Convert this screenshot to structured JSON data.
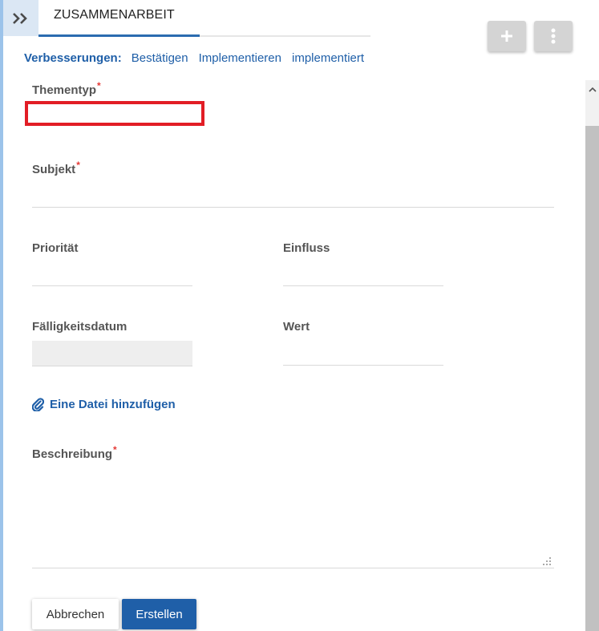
{
  "header": {
    "expand_icon": "double-chevron-right-icon",
    "tab_title": "ZUSAMMENARBEIT",
    "add_icon": "plus-icon",
    "more_icon": "vertical-dots-icon",
    "accent_color": "#2b6cb0"
  },
  "workflow": {
    "label": "Verbesserungen:",
    "steps": [
      "Bestätigen",
      "Implementieren",
      "implementiert"
    ]
  },
  "form": {
    "required_marker": "*",
    "themen_typ": {
      "label": "Thementyp",
      "value": ""
    },
    "subjekt": {
      "label": "Subjekt",
      "value": ""
    },
    "prioritaet": {
      "label": "Priorität",
      "value": ""
    },
    "einfluss": {
      "label": "Einfluss",
      "value": ""
    },
    "faelligkeitsdatum": {
      "label": "Fälligkeitsdatum",
      "value": ""
    },
    "wert": {
      "label": "Wert",
      "value": ""
    },
    "attach": {
      "icon": "paperclip-icon",
      "label": "Eine Datei hinzufügen"
    },
    "beschreibung": {
      "label": "Beschreibung",
      "value": ""
    }
  },
  "actions": {
    "cancel_label": "Abbrechen",
    "create_label": "Erstellen",
    "primary_color": "#1f5fa8"
  }
}
